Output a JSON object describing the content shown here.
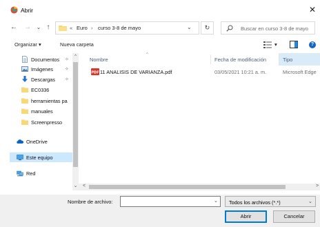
{
  "window": {
    "title": "Abrir",
    "close_glyph": "✕"
  },
  "nav": {
    "back_glyph": "←",
    "forward_glyph": "→",
    "recent_glyph": "⌄",
    "up_glyph": "↑",
    "address": {
      "overflow": "«",
      "segments": [
        "Euro",
        "curso 3-8 de mayo"
      ],
      "separator": "›",
      "dropdown_glyph": "⌄"
    },
    "refresh_glyph": "↻",
    "search_placeholder": "Buscar en curso 3-8 de mayo"
  },
  "toolbar": {
    "organize": "Organizar ▾",
    "new_folder": "Nueva carpeta",
    "view_dropdown": "▾",
    "help": "?"
  },
  "sidebar": {
    "items": [
      {
        "label": "Documentos",
        "icon": "documents-icon",
        "pinned": true
      },
      {
        "label": "Imágenes",
        "icon": "pictures-icon",
        "pinned": true
      },
      {
        "label": "Descargas",
        "icon": "downloads-icon",
        "pinned": true
      },
      {
        "label": "EC0336",
        "icon": "folder-icon",
        "pinned": false
      },
      {
        "label": "herramientas pa",
        "icon": "folder-icon",
        "pinned": false
      },
      {
        "label": "manuales",
        "icon": "folder-icon",
        "pinned": false
      },
      {
        "label": "Screenpresso",
        "icon": "folder-icon",
        "pinned": false
      },
      {
        "label": "OneDrive",
        "icon": "onedrive-icon",
        "pinned": false
      },
      {
        "label": "Este equipo",
        "icon": "computer-icon",
        "pinned": false,
        "selected": true
      },
      {
        "label": "Red",
        "icon": "network-icon",
        "pinned": false
      }
    ],
    "pin_glyph": "✧"
  },
  "file_list": {
    "columns": [
      "Nombre",
      "Fecha de modificación",
      "Tipo"
    ],
    "rows": [
      {
        "name": "11 ANALISIS DE VARIANZA.pdf",
        "modified": "03/05/2021 10:21 a. m.",
        "type": "Microsoft Edge"
      }
    ]
  },
  "scroll": {
    "up": "^",
    "down": "⌄",
    "left": "<",
    "right": ">"
  },
  "bottom": {
    "filename_label": "Nombre de archivo:",
    "filename_value": "",
    "filter_value": "Todos los archivos (*.*)",
    "dropdown_glyph": "⌄",
    "open_button": "Abrir",
    "cancel_button": "Cancelar"
  },
  "colors": {
    "accent": "#0078d7",
    "selection": "#cce8ff",
    "folder": "#f8d775",
    "pdf": "#d9362b"
  }
}
